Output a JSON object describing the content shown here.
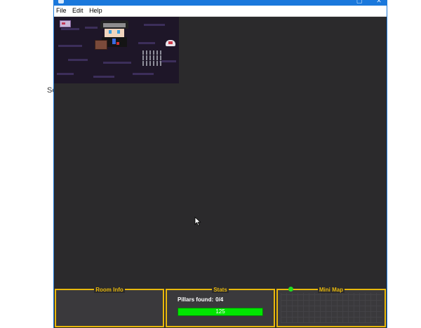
{
  "background_text": "Se",
  "window": {
    "menu": [
      "File",
      "Edit",
      "Help"
    ]
  },
  "panels": {
    "room_info": {
      "title": "Room Info"
    },
    "stats": {
      "title": "Stats",
      "pillars_label": "Pillars found:",
      "pillars_value": "0/4",
      "hp_value": "125",
      "hp_fraction": 1.0
    },
    "mini_map": {
      "title": "Mini Map"
    }
  },
  "colors": {
    "accent": "#e8b80c",
    "health": "#00e600",
    "window_bg": "#2b2a2c",
    "titlebar": "#1a78dc"
  }
}
